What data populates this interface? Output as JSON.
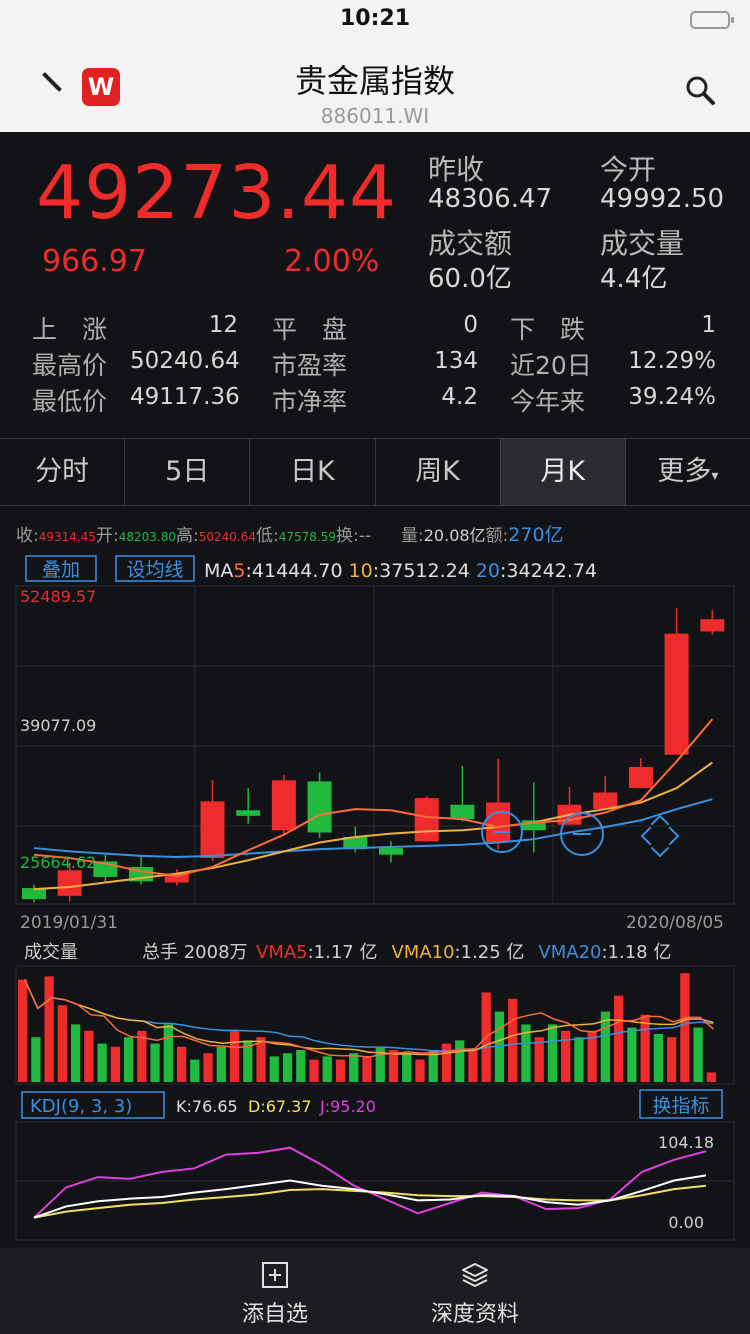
{
  "status": {
    "time": "10:21"
  },
  "nav": {
    "logo": "W",
    "title": "贵金属指数",
    "code": "886011.WI"
  },
  "quote": {
    "price": "49273.44",
    "change": "966.97",
    "change_pct": "2.00%",
    "prev_close_label": "昨收",
    "prev_close": "48306.47",
    "open_label": "今开",
    "open": "49992.50",
    "turnover_label": "成交额",
    "turnover": "60.0亿",
    "volume_label": "成交量",
    "volume": "4.4亿"
  },
  "stats": {
    "up_label": "上　涨",
    "up": "12",
    "flat_label": "平　盘",
    "flat": "0",
    "down_label": "下　跌",
    "down": "1",
    "high_label": "最高价",
    "high": "50240.64",
    "pe_label": "市盈率",
    "pe": "134",
    "d20_label": "近20日",
    "d20": "12.29%",
    "low_label": "最低价",
    "low": "49117.36",
    "pb_label": "市净率",
    "pb": "4.2",
    "ytd_label": "今年来",
    "ytd": "39.24%"
  },
  "tabs": [
    "分时",
    "5日",
    "日K",
    "周K",
    "月K",
    "更多"
  ],
  "kbar": {
    "close_lbl": "收:",
    "close": "49314.45",
    "open_lbl": "开:",
    "open": "48203.80",
    "high_lbl": "高:",
    "high": "50240.64",
    "low_lbl": "低:",
    "low": "47578.59",
    "turn_lbl": "换:",
    "turn": "--",
    "vol_lbl": "量:",
    "vol": "20.08亿",
    "amt_lbl": "额:",
    "amt": "270亿"
  },
  "ma_bar": {
    "overlay_btn": "叠加",
    "ma_btn": "设均线",
    "ma5_lbl": "MA",
    "ma5_n": "5",
    "ma5": ":41444.70",
    "ma10_n": "10",
    "ma10": ":37512.24",
    "ma20_n": "20",
    "ma20": ":34242.74"
  },
  "price_axis": {
    "top": "52489.57",
    "mid": "39077.09",
    "low": "25664.62"
  },
  "date_axis": {
    "start": "2019/01/31",
    "end": "2020/08/05"
  },
  "vol_bar": {
    "title": "成交量",
    "total": "总手 2008万",
    "vma5_lbl": "VMA5",
    "vma5": ":1.17 亿",
    "vma10_lbl": "VMA10",
    "vma10": ":1.25 亿",
    "vma20_lbl": "VMA20",
    "vma20": ":1.18 亿"
  },
  "kdj": {
    "label": "KDJ(9, 3, 3)",
    "k": "K:76.65",
    "d": "D:67.37",
    "j": "J:95.20",
    "switch_btn": "换指标",
    "top": "104.18",
    "bottom": "0.00"
  },
  "bottom": {
    "add_watch": "添自选",
    "depth": "深度资料"
  },
  "colors": {
    "up": "#ef2b2b",
    "down": "#1fba3e",
    "ma5": "#ff6a3a",
    "ma10": "#f0b040",
    "ma20": "#3a90e0",
    "k": "#ffffff",
    "d": "#f0e060",
    "j": "#e040e0"
  },
  "chart_data": {
    "type": "candlestick",
    "x_range": [
      "2019/01/31",
      "2020/08/05"
    ],
    "ylim": [
      25664.62,
      52489.57
    ],
    "candles": [
      {
        "o": 26200,
        "c": 25200,
        "h": 26500,
        "l": 24900
      },
      {
        "o": 25500,
        "c": 27800,
        "h": 28500,
        "l": 25000
      },
      {
        "o": 28600,
        "c": 27200,
        "h": 29200,
        "l": 26800
      },
      {
        "o": 28100,
        "c": 26800,
        "h": 29100,
        "l": 26500
      },
      {
        "o": 26700,
        "c": 27500,
        "h": 27900,
        "l": 26400
      },
      {
        "o": 28900,
        "c": 34000,
        "h": 35900,
        "l": 28600
      },
      {
        "o": 33200,
        "c": 32700,
        "h": 35200,
        "l": 32000
      },
      {
        "o": 31400,
        "c": 35900,
        "h": 36400,
        "l": 31000
      },
      {
        "o": 35800,
        "c": 31200,
        "h": 36600,
        "l": 30700
      },
      {
        "o": 30800,
        "c": 29700,
        "h": 31700,
        "l": 29400
      },
      {
        "o": 29800,
        "c": 29200,
        "h": 30400,
        "l": 28500
      },
      {
        "o": 30400,
        "c": 34300,
        "h": 34500,
        "l": 30400
      },
      {
        "o": 33700,
        "c": 32400,
        "h": 37200,
        "l": 32200
      },
      {
        "o": 30300,
        "c": 33900,
        "h": 37800,
        "l": 29700
      },
      {
        "o": 32300,
        "c": 31400,
        "h": 35700,
        "l": 29400
      },
      {
        "o": 31900,
        "c": 33700,
        "h": 35300,
        "l": 31900
      },
      {
        "o": 33300,
        "c": 34800,
        "h": 36300,
        "l": 33300
      },
      {
        "o": 35200,
        "c": 37100,
        "h": 37900,
        "l": 35200
      },
      {
        "o": 38200,
        "c": 49100,
        "h": 51400,
        "l": 38200
      },
      {
        "o": 49300,
        "c": 50400,
        "h": 51200,
        "l": 49000
      }
    ],
    "ma5": [
      29200,
      28900,
      28400,
      27700,
      27300,
      28100,
      29600,
      31000,
      32800,
      33300,
      33200,
      32600,
      32400,
      31700,
      32100,
      32300,
      33000,
      34100,
      37600,
      41400
    ],
    "ma10": [
      26100,
      26300,
      26700,
      27100,
      27500,
      28000,
      28700,
      29500,
      30300,
      30800,
      31100,
      31300,
      31400,
      31700,
      32100,
      32800,
      33300,
      33900,
      35200,
      37500
    ],
    "ma20": [
      29800,
      29500,
      29300,
      29100,
      29000,
      29100,
      29300,
      29500,
      29700,
      29800,
      29900,
      30000,
      30100,
      30300,
      30600,
      31200,
      31700,
      32300,
      33300,
      34200
    ],
    "volume": [
      {
        "v": 1.6,
        "up": true
      },
      {
        "v": 0.7,
        "up": false
      },
      {
        "v": 1.65,
        "up": true
      },
      {
        "v": 1.2,
        "up": true
      },
      {
        "v": 0.9,
        "up": false
      },
      {
        "v": 0.8,
        "up": true
      },
      {
        "v": 0.6,
        "up": false
      },
      {
        "v": 0.55,
        "up": true
      },
      {
        "v": 0.7,
        "up": false
      },
      {
        "v": 0.8,
        "up": true
      },
      {
        "v": 0.6,
        "up": false
      },
      {
        "v": 0.9,
        "up": false
      },
      {
        "v": 0.55,
        "up": true
      },
      {
        "v": 0.35,
        "up": false
      },
      {
        "v": 0.45,
        "up": true
      },
      {
        "v": 0.55,
        "up": false
      },
      {
        "v": 0.8,
        "up": true
      },
      {
        "v": 0.65,
        "up": false
      },
      {
        "v": 0.7,
        "up": true
      },
      {
        "v": 0.4,
        "up": false
      },
      {
        "v": 0.45,
        "up": false
      },
      {
        "v": 0.5,
        "up": false
      },
      {
        "v": 0.35,
        "up": true
      },
      {
        "v": 0.4,
        "up": false
      },
      {
        "v": 0.35,
        "up": true
      },
      {
        "v": 0.45,
        "up": false
      },
      {
        "v": 0.4,
        "up": true
      },
      {
        "v": 0.55,
        "up": false
      },
      {
        "v": 0.5,
        "up": true
      },
      {
        "v": 0.45,
        "up": false
      },
      {
        "v": 0.35,
        "up": true
      },
      {
        "v": 0.5,
        "up": false
      },
      {
        "v": 0.6,
        "up": true
      },
      {
        "v": 0.65,
        "up": false
      },
      {
        "v": 0.5,
        "up": true
      },
      {
        "v": 1.4,
        "up": true
      },
      {
        "v": 1.1,
        "up": false
      },
      {
        "v": 1.3,
        "up": true
      },
      {
        "v": 0.9,
        "up": false
      },
      {
        "v": 0.7,
        "up": true
      },
      {
        "v": 0.9,
        "up": false
      },
      {
        "v": 0.8,
        "up": true
      },
      {
        "v": 0.7,
        "up": false
      },
      {
        "v": 0.8,
        "up": true
      },
      {
        "v": 1.1,
        "up": false
      },
      {
        "v": 1.35,
        "up": true
      },
      {
        "v": 0.85,
        "up": false
      },
      {
        "v": 1.05,
        "up": true
      },
      {
        "v": 0.75,
        "up": false
      },
      {
        "v": 0.7,
        "up": true
      },
      {
        "v": 1.7,
        "up": true
      },
      {
        "v": 0.85,
        "up": false
      },
      {
        "v": 0.15,
        "up": true
      }
    ],
    "kdj_k": [
      5,
      18,
      24,
      27,
      29,
      34,
      38,
      43,
      48,
      42,
      38,
      32,
      25,
      26,
      31,
      30,
      23,
      20,
      25,
      36,
      48,
      54
    ],
    "kdj_d": [
      5,
      12,
      16,
      20,
      22,
      26,
      29,
      32,
      37,
      38,
      36,
      34,
      31,
      30,
      30,
      29,
      26,
      25,
      25,
      31,
      38,
      42
    ],
    "kdj_j": [
      5,
      40,
      52,
      50,
      58,
      62,
      78,
      80,
      86,
      66,
      42,
      26,
      10,
      22,
      34,
      30,
      15,
      16,
      26,
      58,
      72,
      82
    ]
  }
}
